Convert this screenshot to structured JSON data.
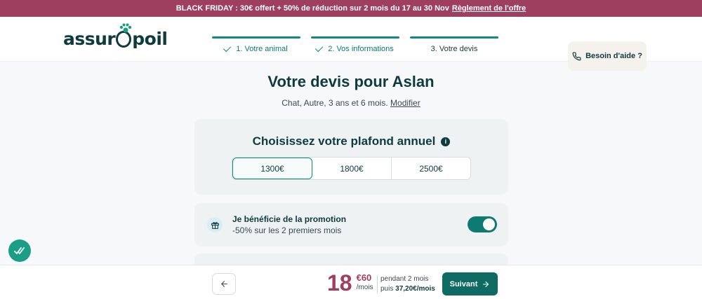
{
  "promo_banner": {
    "text": "BLACK FRIDAY : 30€ offert + 50% de réduction sur 2 mois du 17 au 30 Nov",
    "link": "Règlement de l'offre",
    "color": "#9e3f5f"
  },
  "brand": {
    "logo_left": "assur",
    "logo_right": "poil"
  },
  "steps": [
    {
      "label": "1. Votre animal",
      "state": "done"
    },
    {
      "label": "2. Vos informations",
      "state": "done"
    },
    {
      "label": "3. Votre devis",
      "state": "current"
    }
  ],
  "help": {
    "label": "Besoin d'aide ?",
    "icon": "phone-icon"
  },
  "main": {
    "title": "Votre devis pour Aslan",
    "subtitle": "Chat, Autre, 3 ans et 6 mois.",
    "modify_label": "Modifier"
  },
  "ceiling": {
    "title": "Choisissez votre plafond annuel",
    "info_icon": "i",
    "options": [
      "1300€",
      "1800€",
      "2500€"
    ],
    "selected": "1300€"
  },
  "promotion": {
    "title": "Je bénéficie de la promotion",
    "subtitle": "-50% sur les 2 premiers mois",
    "enabled": true,
    "icon": "gift-icon"
  },
  "footer": {
    "price_int": "18",
    "price_dec": "€60",
    "price_per": "/mois",
    "details_line1": "pendant 2 mois",
    "details_prefix": "puis",
    "details_after": "37,20€/mois",
    "next_label": "Suivant"
  },
  "colors": {
    "accent": "#0e8a80",
    "brand_dark": "#0d3b3e",
    "price": "#9e3f5f"
  }
}
